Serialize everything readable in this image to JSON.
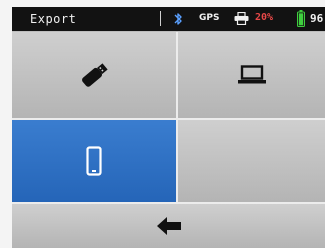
{
  "status_bar": {
    "title": "Export",
    "bluetooth_icon": "bluetooth-icon",
    "gps_label": "GPS",
    "printer_icon": "printer-icon",
    "printer_percent": "20%",
    "printer_percent_color": "#e84848",
    "battery_icon": "battery-icon",
    "battery_percent": "96",
    "battery_color": "#3fcf3f"
  },
  "export_options": [
    {
      "id": "usb",
      "icon": "usb-drive-icon",
      "selected": false
    },
    {
      "id": "computer",
      "icon": "laptop-icon",
      "selected": false
    },
    {
      "id": "phone",
      "icon": "smartphone-icon",
      "selected": true
    },
    {
      "id": "empty",
      "icon": "",
      "selected": false
    }
  ],
  "back": {
    "icon": "back-arrow-icon"
  },
  "colors": {
    "selected_tile": "#2f72c4",
    "tile": "#c2c2c2",
    "status_bar": "#121212"
  }
}
